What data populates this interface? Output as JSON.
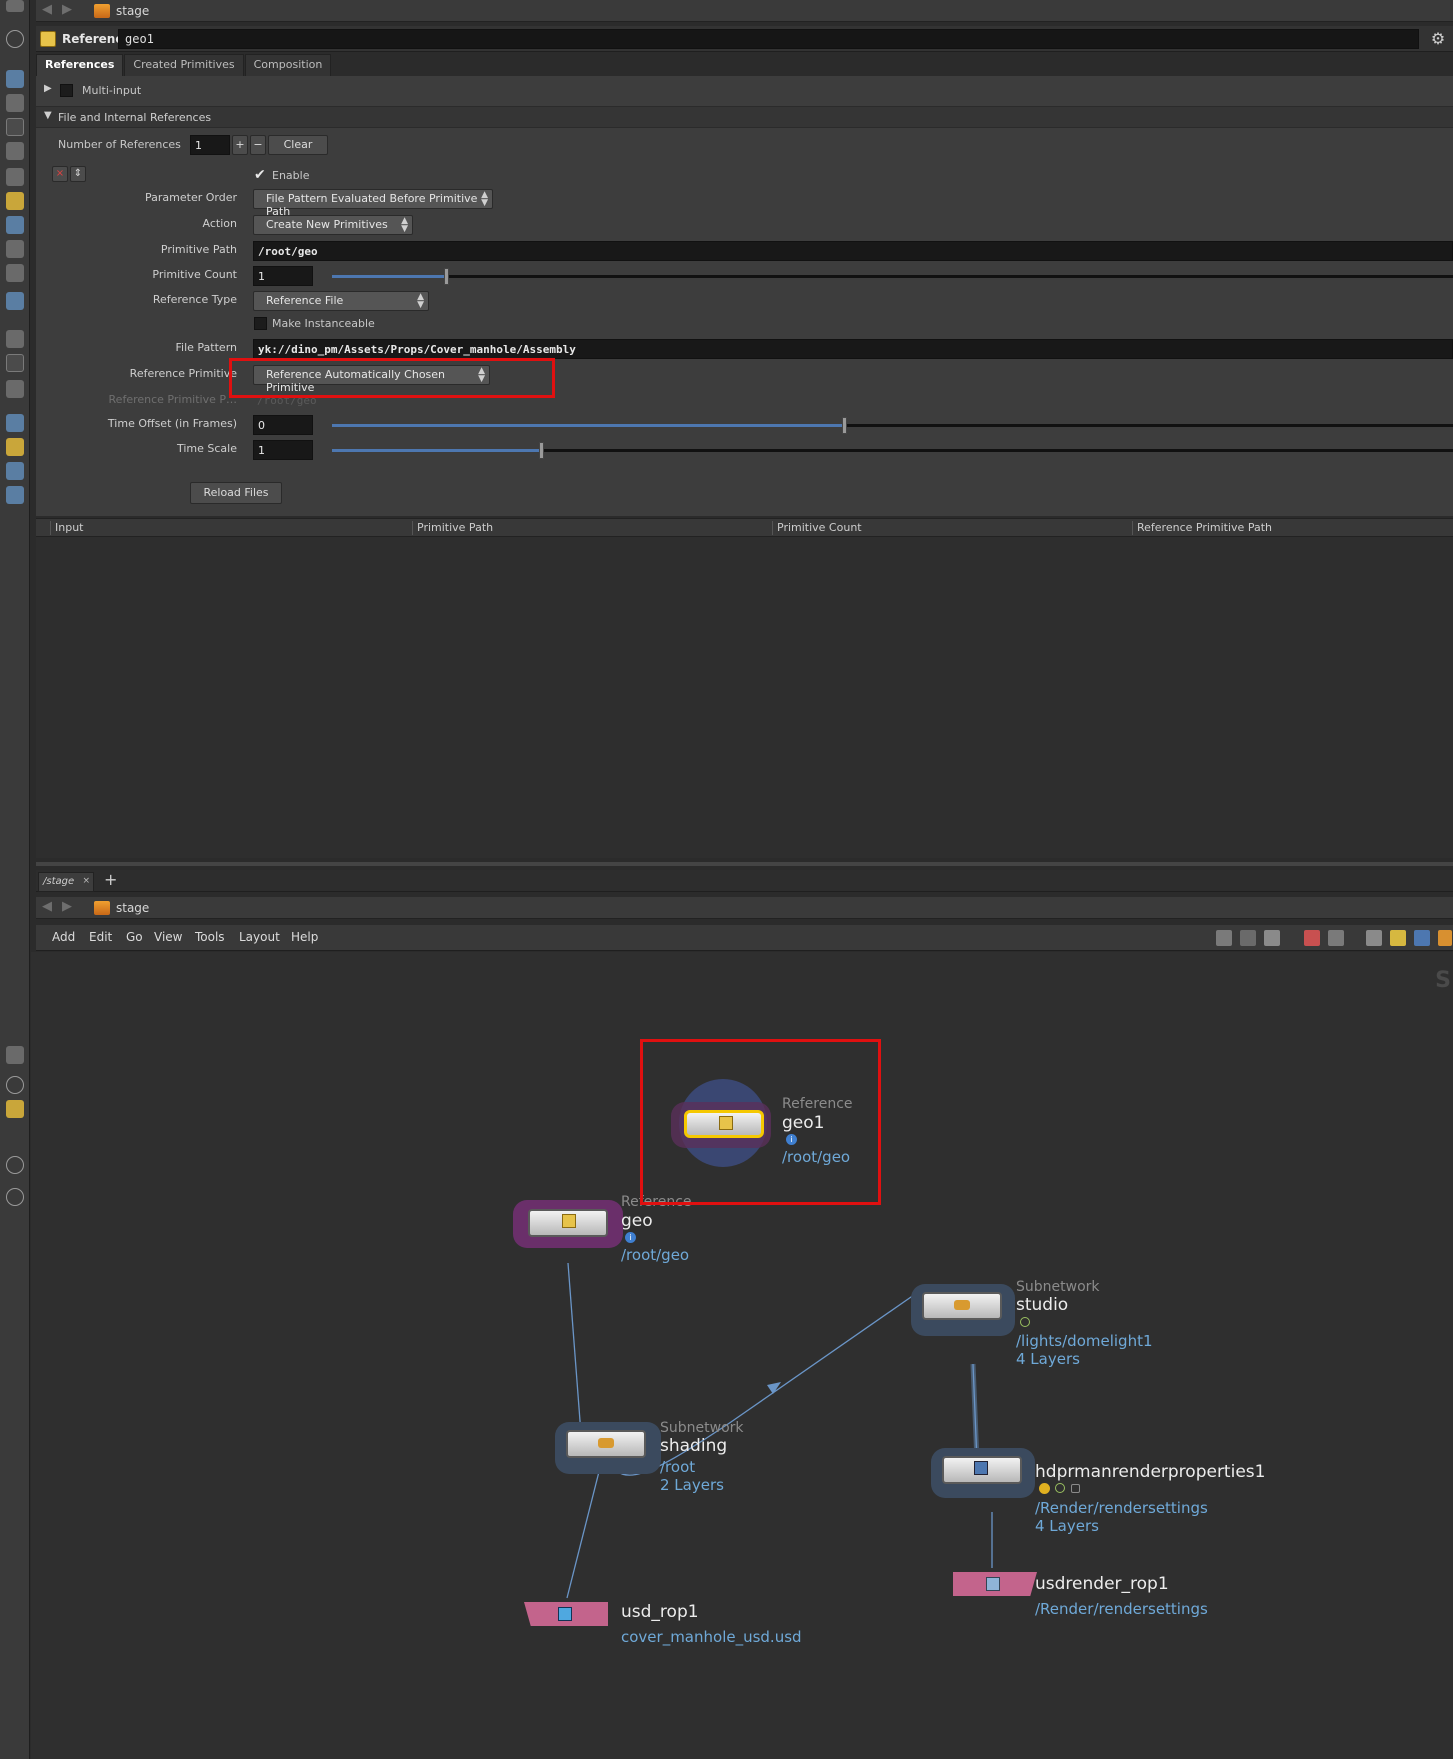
{
  "top_pathbar": {
    "label": "stage"
  },
  "param_header": {
    "node_type": "Reference",
    "node_name": "geo1"
  },
  "tabs": [
    {
      "label": "References",
      "active": true
    },
    {
      "label": "Created Primitives",
      "active": false
    },
    {
      "label": "Composition",
      "active": false
    }
  ],
  "params": {
    "multi_input": {
      "label": "Multi-input"
    },
    "section": {
      "label": "File and Internal References"
    },
    "number_of_references": {
      "label": "Number of References",
      "value": "1",
      "plus": "+",
      "minus": "−",
      "clear": "Clear"
    },
    "small_buttons": {
      "remove": "×",
      "move": "⇕"
    },
    "enable": {
      "label": "Enable",
      "checked": true
    },
    "parameter_order": {
      "label": "Parameter Order",
      "value": "File Pattern Evaluated Before Primitive Path"
    },
    "action": {
      "label": "Action",
      "value": "Create New Primitives"
    },
    "primitive_path": {
      "label": "Primitive Path",
      "value": "/root/geo"
    },
    "primitive_count": {
      "label": "Primitive Count",
      "value": "1",
      "slider_fraction": 0.1
    },
    "reference_type": {
      "label": "Reference Type",
      "value": "Reference File"
    },
    "make_instanceable": {
      "label": "Make Instanceable"
    },
    "file_pattern": {
      "label": "File Pattern",
      "value": "yk://dino_pm/Assets/Props/Cover_manhole/Assembly"
    },
    "reference_primitive": {
      "label": "Reference Primitive",
      "value": "Reference Automatically Chosen Primitive"
    },
    "reference_primitive_path": {
      "label": "Reference Primitive P…",
      "value": "/root/geo"
    },
    "time_offset": {
      "label": "Time Offset (in Frames)",
      "value": "0"
    },
    "time_scale": {
      "label": "Time Scale",
      "value": "1"
    },
    "reload": {
      "label": "Reload Files"
    }
  },
  "sheet": {
    "columns": [
      "Input",
      "Primitive Path",
      "Primitive Count",
      "Reference Primitive Path"
    ]
  },
  "network": {
    "tab": {
      "label": "/stage",
      "close": "×",
      "add": "+"
    },
    "pathbar_label": "stage",
    "menu": [
      "Add",
      "Edit",
      "Go",
      "View",
      "Tools",
      "Layout",
      "Help"
    ],
    "edge_letter": "S",
    "nodes": {
      "geo1": {
        "type": "Reference",
        "name": "geo1",
        "info": "/root/geo"
      },
      "geo": {
        "type": "Reference",
        "name": "geo",
        "info": "/root/geo"
      },
      "studio": {
        "type": "Subnetwork",
        "name": "studio",
        "info": "/lights/domelight1",
        "layers": "4 Layers"
      },
      "shading": {
        "type": "Subnetwork",
        "name": "shading",
        "info": "/root",
        "layers": "2 Layers"
      },
      "hdprman": {
        "name": "hdprmanrenderproperties1",
        "info": "/Render/rendersettings",
        "layers": "4 Layers"
      },
      "usdrender": {
        "name": "usdrender_rop1",
        "info": "/Render/rendersettings"
      },
      "usd_rop": {
        "name": "usd_rop1",
        "info": "cover_manhole_usd.usd"
      }
    }
  },
  "colors": {
    "accent_blue": "#4d77b0",
    "highlight_red": "#e01010",
    "info_blue": "#6fa9d8"
  }
}
